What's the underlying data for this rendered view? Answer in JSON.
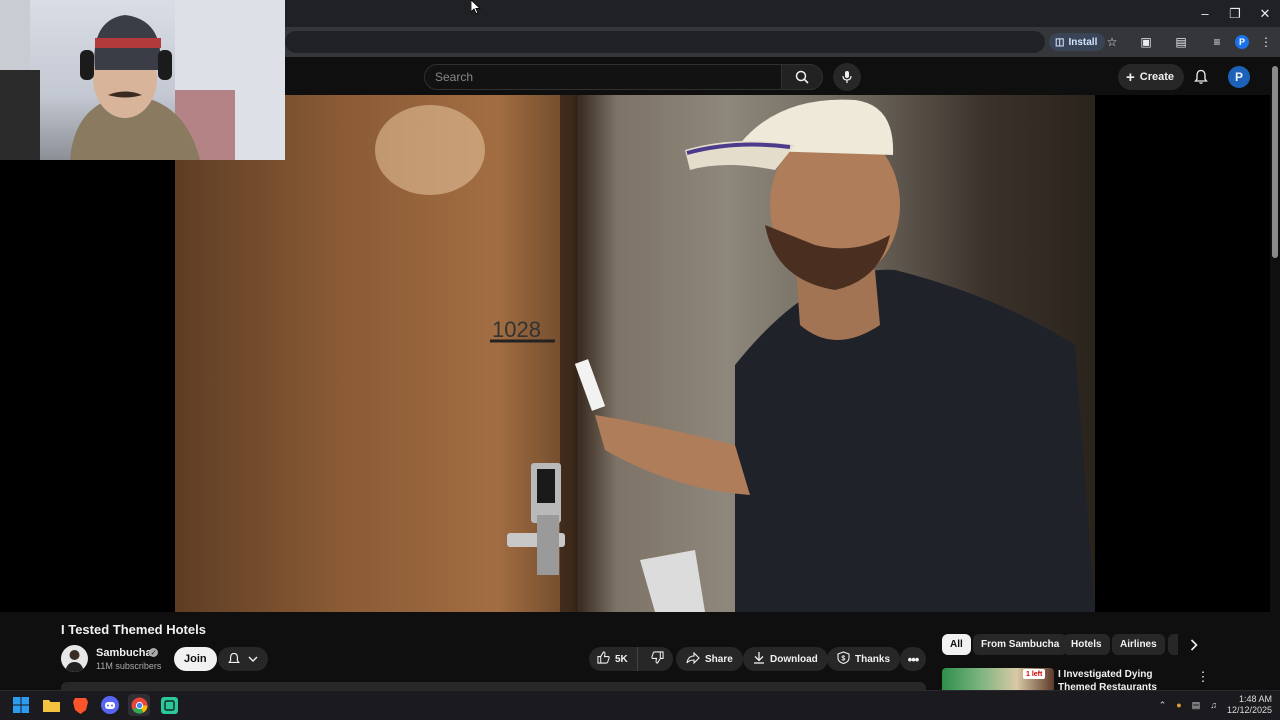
{
  "browser": {
    "install_label": "Install",
    "profile_initial": "P",
    "window_controls": [
      "minimize",
      "restore",
      "close"
    ]
  },
  "masthead": {
    "search_placeholder": "Search",
    "create_label": "Create",
    "avatar_initial": "P"
  },
  "video": {
    "title": "I Tested Themed Hotels",
    "channel_name": "Sambucha",
    "subscribers": "11M subscribers",
    "join_label": "Join",
    "like_count": "5K",
    "share_label": "Share",
    "download_label": "Download",
    "thanks_label": "Thanks",
    "room_number_text": "1028"
  },
  "sidebar": {
    "chips": [
      "All",
      "From Sambucha",
      "Hotels",
      "Airlines"
    ],
    "recommendation": {
      "title": "I Investigated Dying Themed Restaurants",
      "badge": "1 left"
    }
  },
  "taskbar": {
    "apps": [
      "windows-start",
      "file-explorer",
      "brave",
      "discord",
      "chrome",
      "app-green"
    ],
    "time": "1:48 AM",
    "date": "12/12/2025"
  },
  "colors": {
    "background": "#0f0f0f",
    "chip_active": "#f1f1f1",
    "accent_blue": "#1c62b9"
  }
}
